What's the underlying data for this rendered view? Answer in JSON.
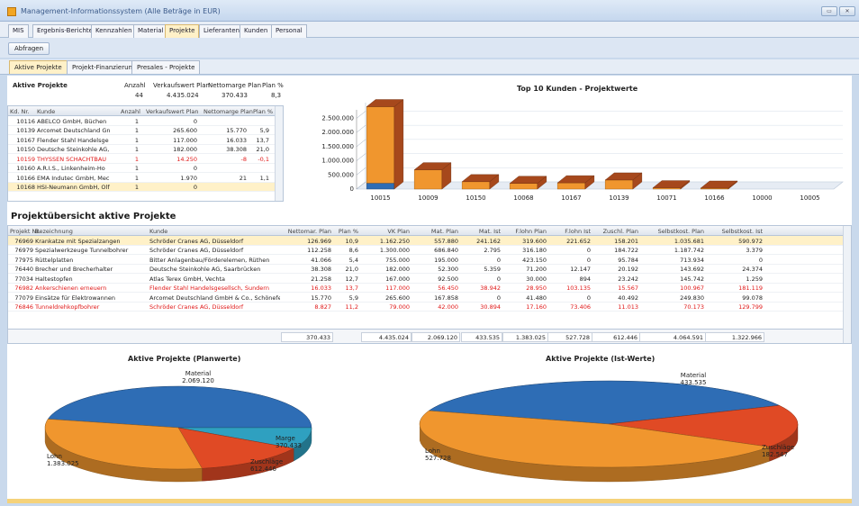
{
  "window": {
    "title": "Management-Informationssystem (Alle Beträge in EUR)"
  },
  "main_tabs": [
    "MIS",
    "Ergebnis-Berichte",
    "Kennzahlen",
    "Material",
    "Projekte",
    "Lieferanten",
    "Kunden",
    "Personal"
  ],
  "active_main_tab": "Projekte",
  "toolbar": {
    "abfragen_label": "Abfragen"
  },
  "sub_tabs": [
    "Aktive Projekte",
    "Projekt-Finanzierung",
    "Presales - Projekte"
  ],
  "summary": {
    "title": "Aktive Projekte",
    "headers": [
      "Anzahl",
      "Verkaufswert Plan",
      "Nettomarge Plan",
      "Plan %"
    ],
    "values": [
      "44",
      "4.435.024",
      "370.433",
      "8,3"
    ]
  },
  "customer_grid": {
    "columns": [
      "Kd. Nr.",
      "Kunde",
      "Anzahl",
      "Verkaufswert Plan",
      "Nettomarge Plan",
      "Plan %"
    ],
    "rows": [
      [
        "10116",
        "ABELCO GmbH, Büchen",
        "1",
        "0",
        "",
        ""
      ],
      [
        "10139",
        "Arcomet Deutschland Gn",
        "1",
        "265.600",
        "15.770",
        "5,9"
      ],
      [
        "10167",
        "Flender Stahl Handelsge",
        "1",
        "117.000",
        "16.033",
        "13,7"
      ],
      [
        "10150",
        "Deutsche Steinkohle AG,",
        "1",
        "182.000",
        "38.308",
        "21,0"
      ],
      [
        "10159",
        "THYSSEN SCHACHTBAU",
        "1",
        "14.250",
        "-8",
        "-0,1"
      ],
      [
        "10160",
        "A.R.I.S., Linkenheim-Ho",
        "1",
        "0",
        "",
        ""
      ],
      [
        "10166",
        "EMA Indutec GmbH, Mec",
        "1",
        "1.970",
        "21",
        "1,1"
      ],
      [
        "10168",
        "HSI-Neumann GmbH, Olf",
        "1",
        "0",
        "",
        ""
      ]
    ]
  },
  "bar_chart_title": "Top 10 Kunden - Projektwerte",
  "chart_data": [
    {
      "type": "bar",
      "title": "Top 10 Kunden - Projektwerte",
      "categories": [
        "10015",
        "10009",
        "10150",
        "10068",
        "10167",
        "10139",
        "10071",
        "10166",
        "10000",
        "10005"
      ],
      "series": [
        {
          "values": [
            2700000,
            680000,
            260000,
            200000,
            220000,
            320000,
            45000,
            12000,
            0,
            0
          ]
        },
        {
          "values": [
            210000,
            0,
            0,
            0,
            0,
            0,
            0,
            0,
            0,
            0
          ]
        }
      ],
      "yticks": [
        "0",
        "500.000",
        "1.000.000",
        "1.500.000",
        "2.000.000",
        "2.500.000"
      ],
      "ylim": [
        0,
        2800000
      ],
      "colors": [
        "#f0962e",
        "#2e6db5",
        "#a6481c"
      ]
    },
    {
      "type": "pie",
      "title": "Aktive Projekte (Planwerte)",
      "labels": [
        "Material",
        "Marge",
        "Zuschläge",
        "Lohn"
      ],
      "values": [
        2069120,
        370433,
        612446,
        1383025
      ],
      "label_values": [
        "2.069.120",
        "370.433",
        "612.446",
        "1.383.025"
      ],
      "colors": [
        "#2e6db5",
        "#2fa0c0",
        "#e04a25",
        "#f0962e"
      ]
    },
    {
      "type": "pie",
      "title": "Aktive Projekte (Ist-Werte)",
      "labels": [
        "Material",
        "Zuschläge",
        "Lohn"
      ],
      "values": [
        433535,
        182547,
        527728
      ],
      "label_values": [
        "433.535",
        "182.547",
        "527.728"
      ],
      "colors": [
        "#2e6db5",
        "#e04a25",
        "#f0962e"
      ]
    }
  ],
  "overview": {
    "title": "Projektübersicht aktive Projekte",
    "columns": [
      "Projekt Nr.",
      "Bezeichnung",
      "Kunde",
      "Nettomar. Plan",
      "Plan %",
      "VK Plan",
      "Mat. Plan",
      "Mat. Ist",
      "F.lohn Plan",
      "F.lohn Ist",
      "Zuschl. Plan",
      "Selbstkost. Plan",
      "Selbstkost. Ist"
    ],
    "rows": [
      {
        "red": false,
        "sel": true,
        "cells": [
          "76969",
          "Krankatze mit Spezialzangen",
          "Schröder Cranes AG, Düsseldorf",
          "126.969",
          "10,9",
          "1.162.250",
          "557.880",
          "241.162",
          "319.600",
          "221.652",
          "158.201",
          "1.035.681",
          "590.972"
        ]
      },
      {
        "red": false,
        "sel": false,
        "cells": [
          "76979",
          "Spezialwerkzeuge Tunnelbohrer",
          "Schröder Cranes AG, Düsseldorf",
          "112.258",
          "8,6",
          "1.300.000",
          "686.840",
          "2.795",
          "316.180",
          "0",
          "184.722",
          "1.187.742",
          "3.379"
        ]
      },
      {
        "red": false,
        "sel": false,
        "cells": [
          "77975",
          "Rüttelplatten",
          "Bitter Anlagenbau/Förderelemen, Rüthen",
          "41.066",
          "5,4",
          "755.000",
          "195.000",
          "0",
          "423.150",
          "0",
          "95.784",
          "713.934",
          "0"
        ]
      },
      {
        "red": false,
        "sel": false,
        "cells": [
          "76440",
          "Brecher und Brecherhalter",
          "Deutsche Steinkohle AG, Saarbrücken",
          "38.308",
          "21,0",
          "182.000",
          "52.300",
          "5.359",
          "71.200",
          "12.147",
          "20.192",
          "143.692",
          "24.374"
        ]
      },
      {
        "red": false,
        "sel": false,
        "cells": [
          "77034",
          "Haltestopfen",
          "Atlas Terex GmbH, Vechta",
          "21.258",
          "12,7",
          "167.000",
          "92.500",
          "0",
          "30.000",
          "894",
          "23.242",
          "145.742",
          "1.259"
        ]
      },
      {
        "red": true,
        "sel": false,
        "cells": [
          "76982",
          "Ankerschienen erneuern",
          "Flender Stahl Handelsgesellsch, Sundern",
          "16.033",
          "13,7",
          "117.000",
          "56.450",
          "38.942",
          "28.950",
          "103.135",
          "15.567",
          "100.967",
          "181.119"
        ]
      },
      {
        "red": false,
        "sel": false,
        "cells": [
          "77079",
          "Einsätze für Elektrowannen",
          "Arcomet Deutschland GmbH & Co., Schönefeld",
          "15.770",
          "5,9",
          "265.600",
          "167.858",
          "0",
          "41.480",
          "0",
          "40.492",
          "249.830",
          "99.078"
        ]
      },
      {
        "red": true,
        "sel": false,
        "cells": [
          "76846",
          "Tunneldrehkopfbohrer",
          "Schröder Cranes AG, Düsseldorf",
          "8.827",
          "11,2",
          "79.000",
          "42.000",
          "30.894",
          "17.160",
          "73.406",
          "11.013",
          "70.173",
          "129.799"
        ]
      }
    ],
    "totals": [
      "370.433",
      "4.435.024",
      "2.069.120",
      "433.535",
      "1.383.025",
      "527.728",
      "612.446",
      "4.064.591",
      "1.322.966"
    ]
  }
}
